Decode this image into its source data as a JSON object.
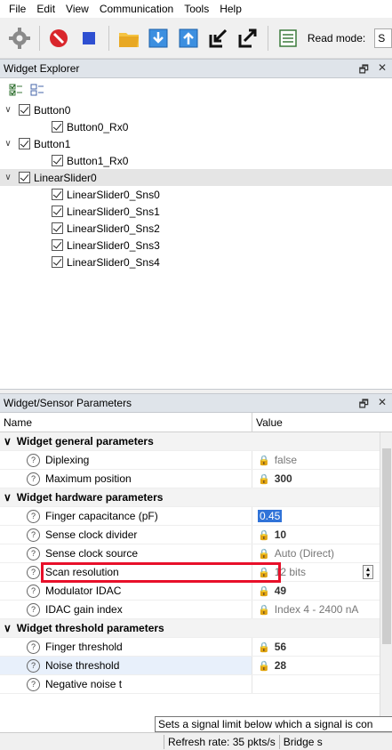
{
  "menu": {
    "file": "File",
    "edit": "Edit",
    "view": "View",
    "communication": "Communication",
    "tools": "Tools",
    "help": "Help"
  },
  "toolbar": {
    "read_mode_label": "Read mode:",
    "read_mode_value": "S"
  },
  "widget_explorer": {
    "title": "Widget Explorer",
    "tree": [
      {
        "label": "Button0",
        "children": [
          "Button0_Rx0"
        ]
      },
      {
        "label": "Button1",
        "children": [
          "Button1_Rx0"
        ]
      },
      {
        "label": "LinearSlider0",
        "children": [
          "LinearSlider0_Sns0",
          "LinearSlider0_Sns1",
          "LinearSlider0_Sns2",
          "LinearSlider0_Sns3",
          "LinearSlider0_Sns4"
        ]
      }
    ]
  },
  "params": {
    "title": "Widget/Sensor Parameters",
    "col_name": "Name",
    "col_value": "Value",
    "groups": [
      {
        "label": "Widget general parameters",
        "rows": [
          {
            "name": "Diplexing",
            "value": "false"
          },
          {
            "name": "Maximum position",
            "value": "300"
          }
        ]
      },
      {
        "label": "Widget hardware parameters",
        "rows": [
          {
            "name": "Finger capacitance (pF)",
            "value": "0.45"
          },
          {
            "name": "Sense clock divider",
            "value": "10"
          },
          {
            "name": "Sense clock source",
            "value": "Auto (Direct)"
          },
          {
            "name": "Scan resolution",
            "value": "12 bits"
          },
          {
            "name": "Modulator IDAC",
            "value": "49"
          },
          {
            "name": "IDAC gain index",
            "value": "Index 4 - 2400 nA"
          }
        ]
      },
      {
        "label": "Widget threshold parameters",
        "rows": [
          {
            "name": "Finger threshold",
            "value": "56"
          },
          {
            "name": "Noise threshold",
            "value": "28"
          },
          {
            "name": "Negative noise t",
            "value": ""
          }
        ]
      }
    ]
  },
  "tooltip": "Sets a signal limit below which a signal is con",
  "status": {
    "refresh": "Refresh rate:  35 pkts/s",
    "bridge": "Bridge s"
  }
}
